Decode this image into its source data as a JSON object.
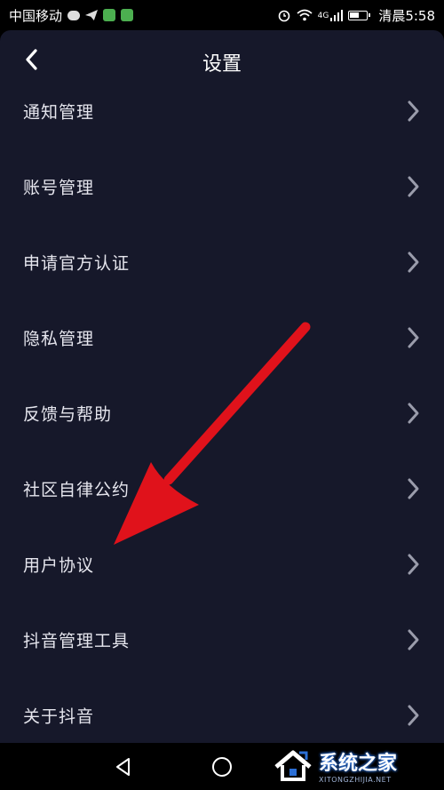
{
  "status_bar": {
    "carrier": "中国移动",
    "network": "4G",
    "time": "清晨5:58"
  },
  "header": {
    "title": "设置"
  },
  "menu": {
    "items": [
      {
        "label": "通知管理"
      },
      {
        "label": "账号管理"
      },
      {
        "label": "申请官方认证"
      },
      {
        "label": "隐私管理"
      },
      {
        "label": "反馈与帮助"
      },
      {
        "label": "社区自律公约"
      },
      {
        "label": "用户协议"
      },
      {
        "label": "抖音管理工具"
      },
      {
        "label": "关于抖音"
      }
    ]
  },
  "watermark": {
    "main": "系统之家",
    "sub": "XITONGZHIJIA.NET"
  },
  "colors": {
    "background": "#16182a",
    "arrow": "#e0121b",
    "text": "#e6e6ee"
  }
}
